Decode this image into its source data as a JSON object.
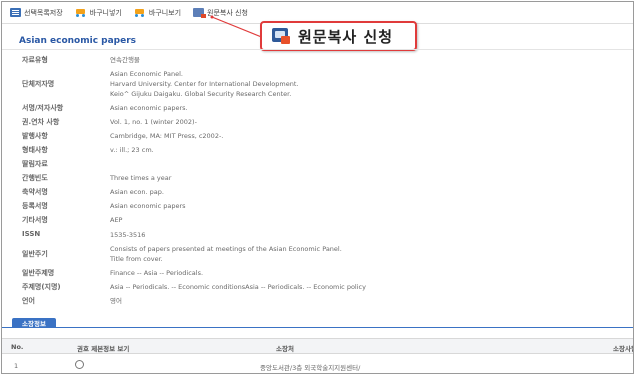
{
  "toolbar": {
    "items": [
      {
        "label": "선택목록저장",
        "icon": "list-icon"
      },
      {
        "label": "바구니넣기",
        "icon": "cart-add-icon"
      },
      {
        "label": "바구니보기",
        "icon": "cart-view-icon"
      },
      {
        "label": "원문복사 신청",
        "icon": "copy-request-icon"
      }
    ]
  },
  "callout": {
    "label": "원문복사 신청",
    "border_color": "#e03b3b"
  },
  "record": {
    "title": "Asian economic papers",
    "fields": [
      {
        "key": "자료유형",
        "lines": [
          "연속간행물"
        ]
      },
      {
        "key": "단체저자명",
        "lines": [
          "Asian Economic Panel.",
          "Harvard University. Center for International Development.",
          "Keio^ Gijuku Daigaku. Global Security Research Center."
        ]
      },
      {
        "key": "서명/저자사항",
        "lines": [
          "Asian economic papers."
        ]
      },
      {
        "key": "권.연차 사항",
        "lines": [
          "Vol. 1, no. 1 (winter 2002)-"
        ]
      },
      {
        "key": "발행사항",
        "lines": [
          "Cambridge, MA: MIT Press, c2002-."
        ]
      },
      {
        "key": "형태사항",
        "lines": [
          "v.: ill.; 23 cm."
        ]
      },
      {
        "key": "딸림자료",
        "lines": [
          ""
        ]
      },
      {
        "key": "간행빈도",
        "lines": [
          "Three times a year"
        ]
      },
      {
        "key": "축약서명",
        "lines": [
          "Asian econ. pap."
        ]
      },
      {
        "key": "등록서명",
        "lines": [
          "Asian economic papers"
        ]
      },
      {
        "key": "기타서명",
        "lines": [
          "AEP"
        ]
      },
      {
        "key": "ISSN",
        "lines": [
          "1535-3516"
        ]
      },
      {
        "key": "일반주기",
        "lines": [
          "Consists of papers presented at meetings of the Asian Economic Panel.",
          "Title from cover."
        ]
      },
      {
        "key": "일반주제명",
        "lines": [
          "Finance -- Asia -- Periodicals."
        ]
      },
      {
        "key": "주제명(지명)",
        "lines": [
          "Asia -- Periodicals. -- Economic conditionsAsia -- Periodicals. -- Economic policy"
        ]
      },
      {
        "key": "언어",
        "lines": [
          "영어"
        ]
      }
    ]
  },
  "holdings": {
    "tab_label": "소장정보",
    "columns": [
      "No.",
      "권호 제본정보 보기",
      "소장처",
      "소장사항"
    ],
    "rows": [
      {
        "no": "1",
        "location": "중앙도서관/3층 외국학술지지원센터/"
      }
    ]
  }
}
